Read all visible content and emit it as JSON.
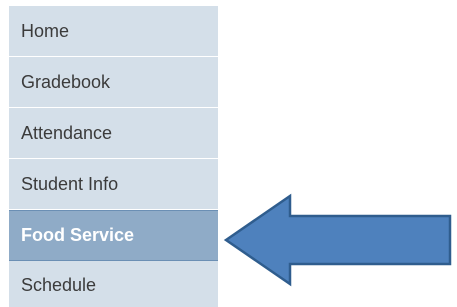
{
  "sidebar": {
    "items": [
      {
        "label": "Home",
        "selected": false
      },
      {
        "label": "Gradebook",
        "selected": false
      },
      {
        "label": "Attendance",
        "selected": false
      },
      {
        "label": "Student Info",
        "selected": false
      },
      {
        "label": "Food Service",
        "selected": true
      },
      {
        "label": "Schedule",
        "selected": false
      }
    ]
  },
  "colors": {
    "item_background": "#d4dfe9",
    "item_selected_background": "#8fabc7",
    "arrow_fill": "#4e81bd",
    "arrow_stroke": "#2f5d8e"
  },
  "arrow_icon": "left-arrow-icon"
}
